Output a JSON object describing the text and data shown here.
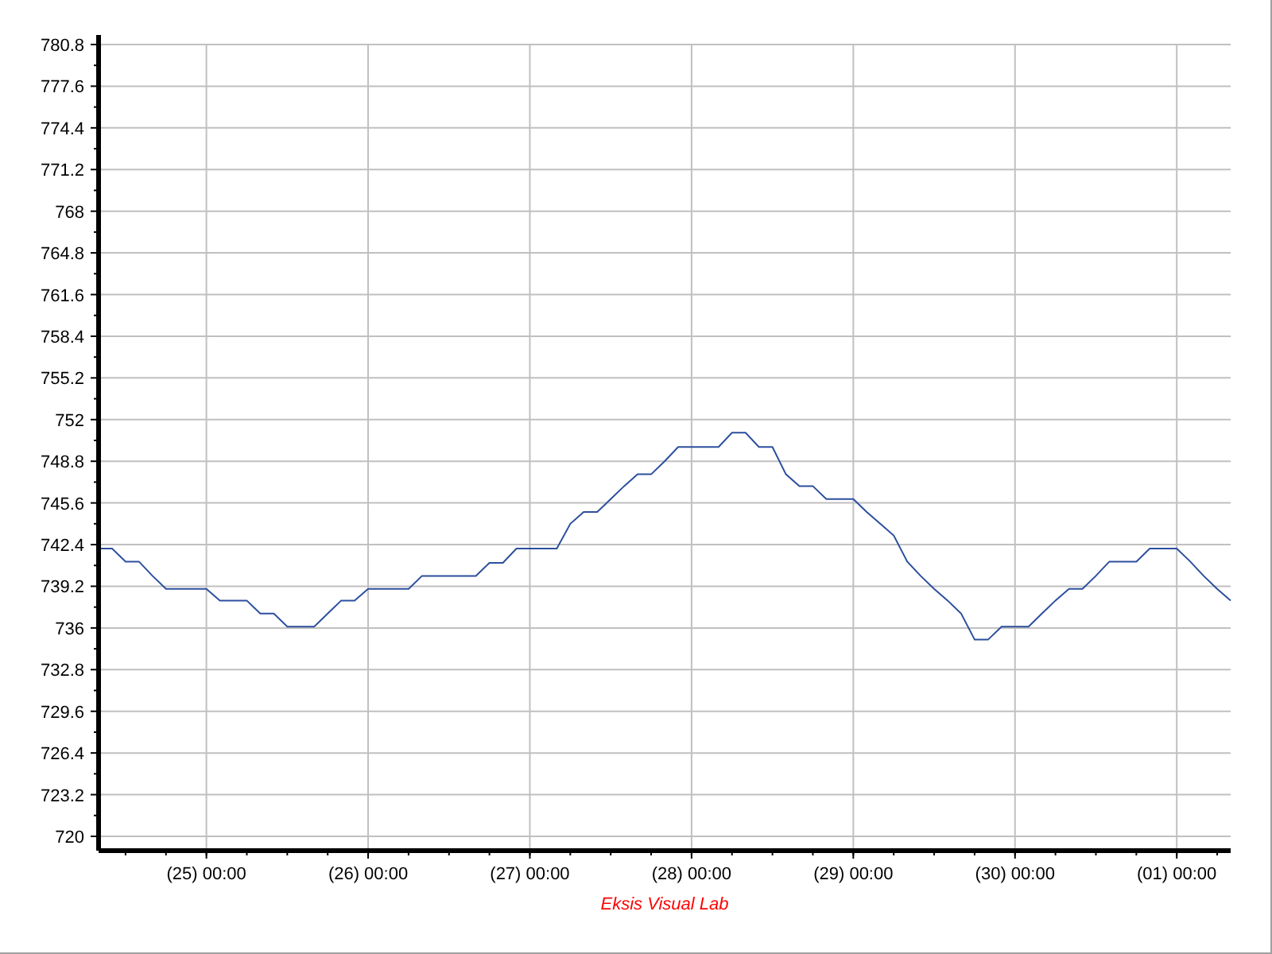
{
  "chart": {
    "chart_data": {
      "type": "line",
      "xlabel": "Eksis Visual Lab",
      "grid": true,
      "categories": [
        null,
        null,
        null,
        null,
        null,
        null,
        null,
        null,
        "(25) 00:00",
        null,
        null,
        null,
        null,
        null,
        null,
        null,
        null,
        null,
        null,
        null,
        "(26) 00:00",
        null,
        null,
        null,
        null,
        null,
        null,
        null,
        null,
        null,
        null,
        null,
        "(27) 00:00",
        null,
        null,
        null,
        null,
        null,
        null,
        null,
        null,
        null,
        null,
        null,
        "(28) 00:00",
        null,
        null,
        null,
        null,
        null,
        null,
        null,
        null,
        null,
        null,
        null,
        "(29) 00:00",
        null,
        null,
        null,
        null,
        null,
        null,
        null,
        null,
        null,
        null,
        null,
        "(30) 00:00",
        null,
        null,
        null,
        null,
        null,
        null,
        null,
        null,
        null,
        null,
        null,
        "(01) 00:00",
        null,
        null,
        null,
        null
      ],
      "series": [
        {
          "color": "#2c4f9e",
          "values": [
            742.1,
            742.1,
            741.1,
            741.1,
            740.0,
            739.0,
            739.0,
            739.0,
            739.0,
            738.1,
            738.1,
            738.1,
            737.1,
            737.1,
            736.1,
            736.1,
            736.1,
            737.1,
            738.1,
            738.1,
            739.0,
            739.0,
            739.0,
            739.0,
            740.0,
            740.0,
            740.0,
            740.0,
            740.0,
            741.0,
            741.0,
            742.1,
            742.1,
            742.1,
            742.1,
            744.0,
            744.9,
            744.9,
            745.9,
            746.9,
            747.8,
            747.8,
            748.8,
            749.9,
            749.9,
            749.9,
            749.9,
            751.0,
            751.0,
            749.9,
            749.9,
            747.8,
            746.9,
            746.9,
            745.9,
            745.9,
            745.9,
            744.9,
            744.0,
            743.1,
            741.1,
            740.0,
            739.0,
            738.1,
            737.1,
            735.1,
            735.1,
            736.1,
            736.1,
            736.1,
            737.1,
            738.1,
            739.0,
            739.0,
            740.0,
            741.1,
            741.1,
            741.1,
            742.1,
            742.1,
            742.1,
            741.1,
            740.0,
            739.0,
            738.1
          ]
        }
      ],
      "ylim": [
        718.9,
        780.8
      ],
      "yticks": [
        720,
        723.2,
        726.4,
        729.6,
        732.8,
        736,
        739.2,
        742.4,
        745.6,
        748.8,
        752,
        755.2,
        758.4,
        761.6,
        764.8,
        768,
        771.2,
        774.4,
        777.6,
        780.8
      ]
    }
  }
}
